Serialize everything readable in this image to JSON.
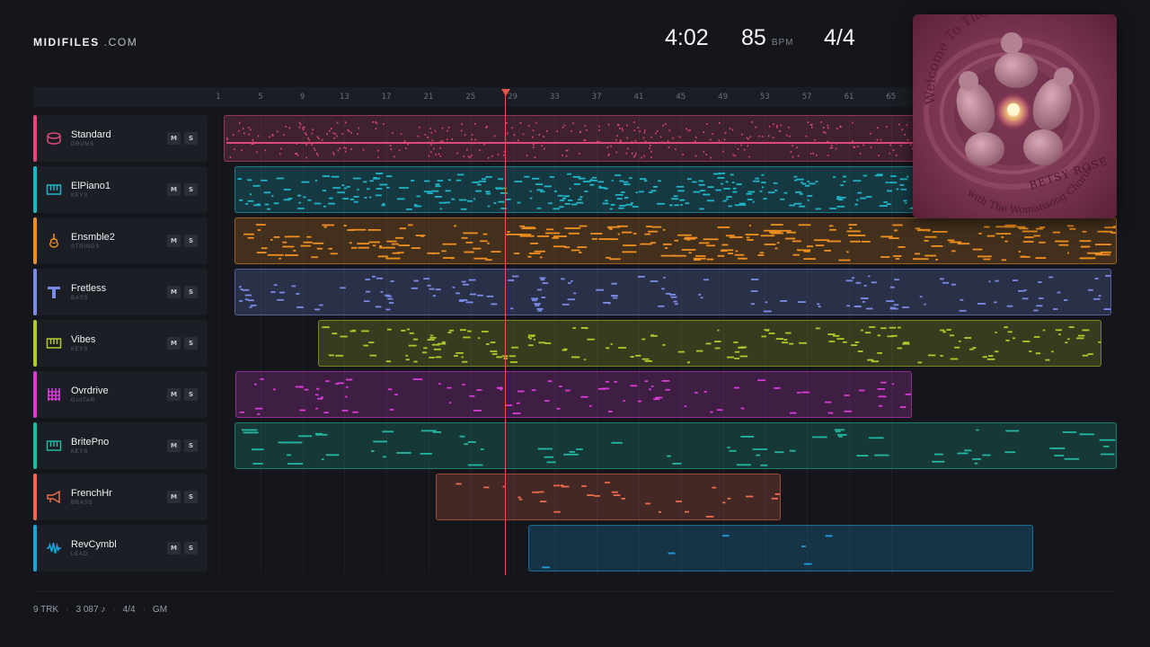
{
  "brand": {
    "name": "MIDIFILES",
    "suffix": " .COM"
  },
  "stats": {
    "time": "4:02",
    "tempo": "85",
    "tempo_unit": "BPM",
    "meter": "4/4"
  },
  "ruler": {
    "ticks": [
      "1",
      "5",
      "9",
      "13",
      "17",
      "21",
      "25",
      "29",
      "33",
      "37",
      "41",
      "45",
      "49",
      "53",
      "57",
      "61",
      "65"
    ]
  },
  "playhead": {
    "bar": 28.3
  },
  "tracks": [
    {
      "name": "Standard",
      "category": "DRUMS",
      "color": "#e0497a",
      "icon": "drum-icon",
      "mute": "M",
      "solo": "S"
    },
    {
      "name": "ElPiano1",
      "category": "KEYS",
      "color": "#1fb5c9",
      "icon": "keyboard-icon",
      "mute": "M",
      "solo": "S"
    },
    {
      "name": "Ensmble2",
      "category": "STRINGS",
      "color": "#ef8f1f",
      "icon": "violin-icon",
      "mute": "M",
      "solo": "S"
    },
    {
      "name": "Fretless",
      "category": "BASS",
      "color": "#7b8ce8",
      "icon": "bass-icon",
      "mute": "M",
      "solo": "S"
    },
    {
      "name": "Vibes",
      "category": "KEYS",
      "color": "#b3c82a",
      "icon": "keyboard-icon",
      "mute": "M",
      "solo": "S"
    },
    {
      "name": "Ovrdrive",
      "category": "GUITAR",
      "color": "#d93bd8",
      "icon": "guitar-icon",
      "mute": "M",
      "solo": "S"
    },
    {
      "name": "BritePno",
      "category": "KEYS",
      "color": "#22b7a0",
      "icon": "keyboard-icon",
      "mute": "M",
      "solo": "S"
    },
    {
      "name": "FrenchHr",
      "category": "BRASS",
      "color": "#ee6a4c",
      "icon": "horn-icon",
      "mute": "M",
      "solo": "S"
    },
    {
      "name": "RevCymbl",
      "category": "LEAD",
      "color": "#1f9ee0",
      "icon": "waveform-icon",
      "mute": "M",
      "solo": "S"
    }
  ],
  "album": {
    "title": "Welcome To The Circle",
    "artist": "BETSY ROSE",
    "subtitle": "with The Womansong Chorus"
  },
  "footer": {
    "tracks": "9 TRK",
    "notes": "3 087 ♪",
    "meter": "4/4",
    "standard": "GM"
  }
}
